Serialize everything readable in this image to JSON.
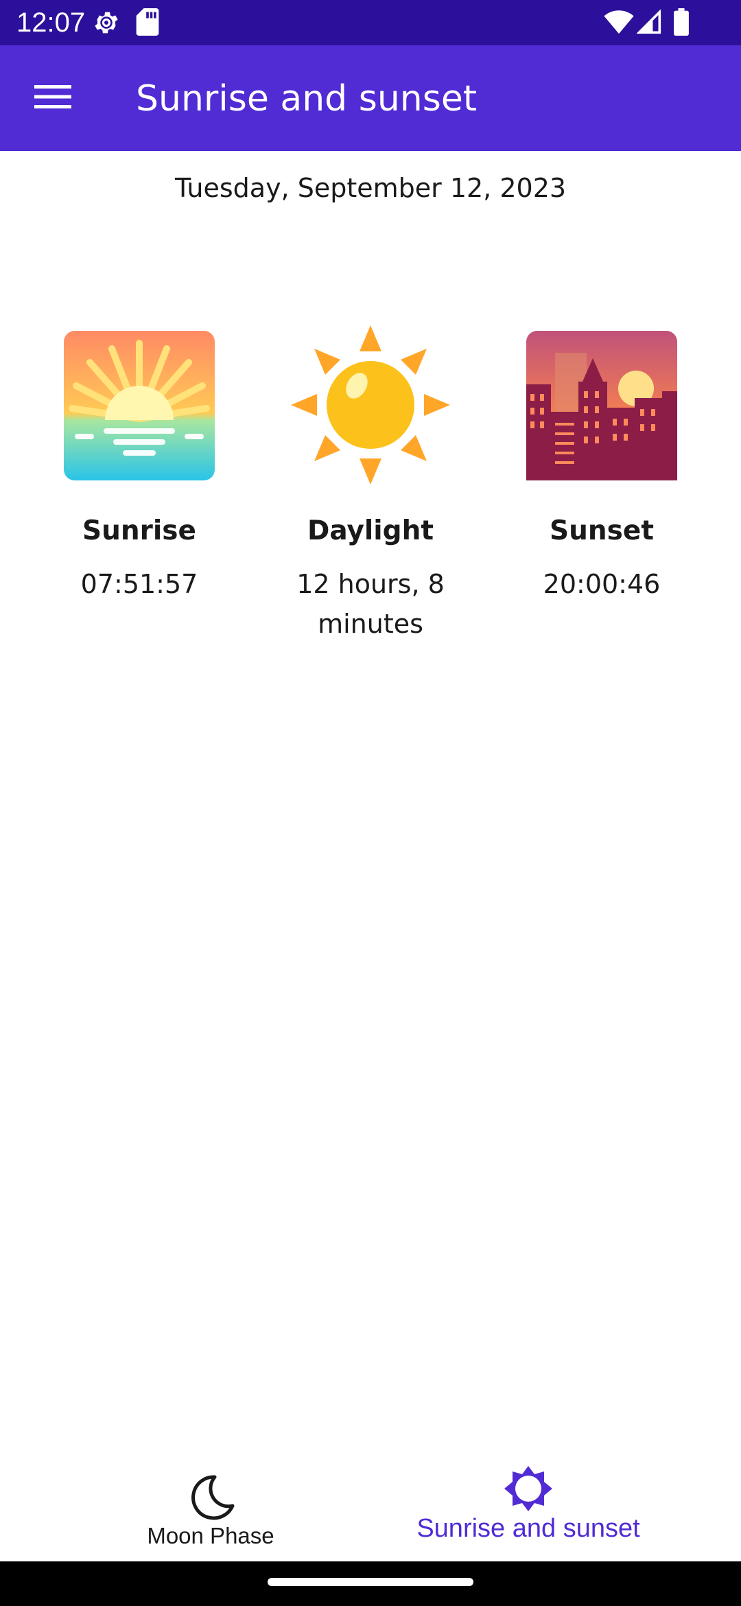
{
  "status_bar": {
    "time": "12:07",
    "left_icons": [
      "settings-icon",
      "sd-card-icon"
    ],
    "right_icons": [
      "wifi-icon",
      "signal-icon",
      "battery-icon"
    ]
  },
  "app_bar": {
    "title": "Sunrise and sunset",
    "menu_icon": "hamburger-menu-icon"
  },
  "content": {
    "date": "Tuesday, September 12, 2023",
    "sunrise": {
      "label": "Sunrise",
      "value": "07:51:57",
      "icon": "sunrise-icon"
    },
    "daylight": {
      "label": "Daylight",
      "value": "12 hours, 8 minutes",
      "icon": "sun-icon"
    },
    "sunset": {
      "label": "Sunset",
      "value": "20:00:46",
      "icon": "sunset-city-icon"
    }
  },
  "tabs": [
    {
      "label": "Moon Phase",
      "icon": "moon-icon",
      "selected": false
    },
    {
      "label": "Sunrise and sunset",
      "icon": "sun-outline-icon",
      "selected": true
    }
  ],
  "colors": {
    "status_bar": "#2c0f9a",
    "app_bar": "#512bd4",
    "accent": "#512bd4",
    "text": "#1a1a1a"
  }
}
